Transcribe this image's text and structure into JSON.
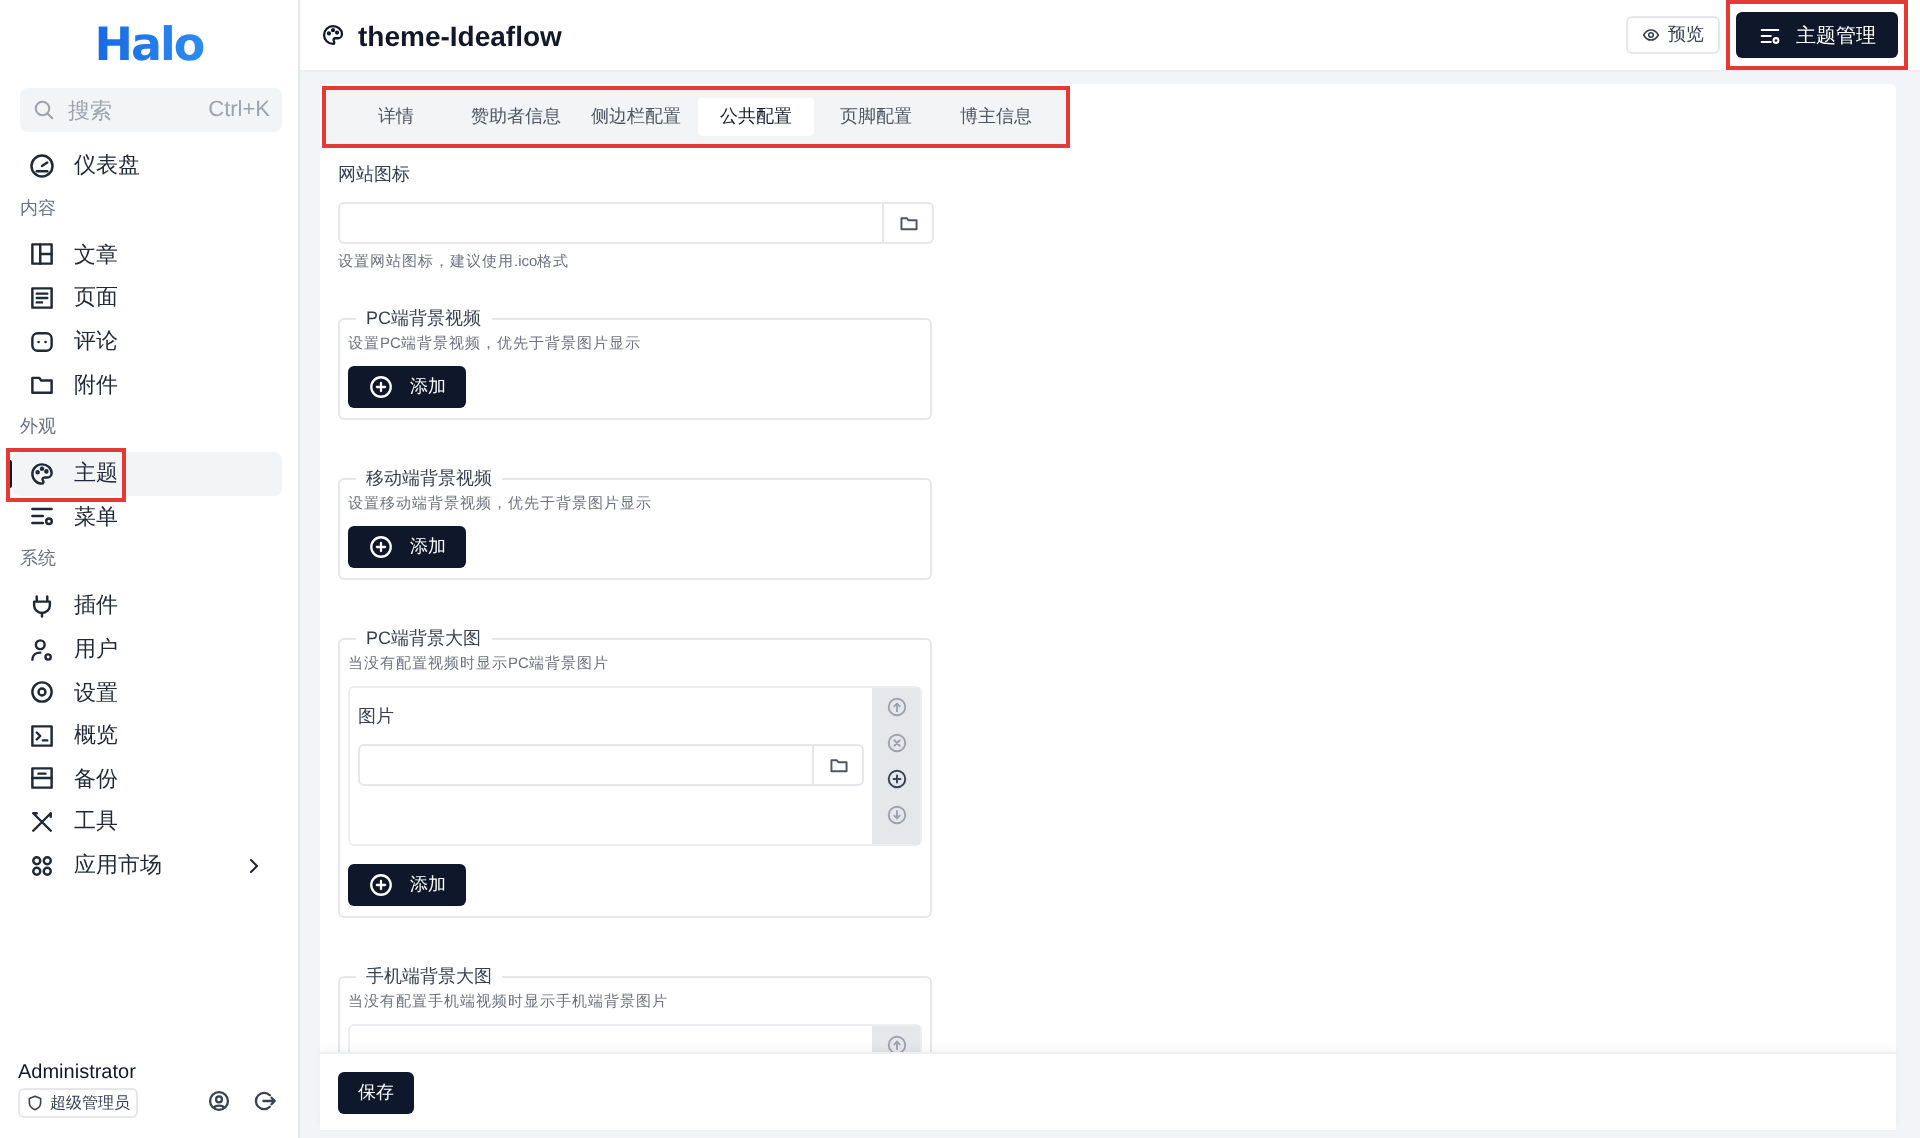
{
  "sidebar": {
    "logo": "Halo",
    "search": {
      "placeholder": "搜索",
      "shortcut": "Ctrl+K"
    },
    "groups": [
      {
        "items": [
          {
            "label": "仪表盘",
            "selected": false,
            "expandable": false
          }
        ]
      },
      {
        "heading": "内容",
        "items": [
          {
            "label": "文章",
            "selected": false,
            "expandable": false
          },
          {
            "label": "页面",
            "selected": false,
            "expandable": false
          },
          {
            "label": "评论",
            "selected": false,
            "expandable": false
          },
          {
            "label": "附件",
            "selected": false,
            "expandable": false
          }
        ]
      },
      {
        "heading": "外观",
        "items": [
          {
            "label": "主题",
            "selected": true,
            "highlighted": true,
            "expandable": false
          },
          {
            "label": "菜单",
            "selected": false,
            "highlighted": false,
            "expandable": false
          }
        ]
      },
      {
        "heading": "系统",
        "items": [
          {
            "label": "插件",
            "selected": false,
            "expandable": false
          },
          {
            "label": "用户",
            "selected": false,
            "expandable": false
          },
          {
            "label": "设置",
            "selected": false,
            "expandable": false
          },
          {
            "label": "概览",
            "selected": false,
            "expandable": false
          },
          {
            "label": "备份",
            "selected": false,
            "expandable": false
          },
          {
            "label": "工具",
            "selected": false,
            "expandable": false
          },
          {
            "label": "应用市场",
            "selected": false,
            "expandable": true
          }
        ]
      }
    ],
    "user": {
      "name": "Administrator",
      "role": "超级管理员"
    }
  },
  "header": {
    "title": "theme-Ideaflow",
    "preview_button": "预览",
    "manage_button": {
      "label": "主题管理",
      "highlighted": true
    }
  },
  "tabs": {
    "highlighted": true,
    "items": [
      {
        "label": "详情",
        "selected": false
      },
      {
        "label": "赞助者信息",
        "selected": false
      },
      {
        "label": "侧边栏配置",
        "selected": false
      },
      {
        "label": "公共配置",
        "selected": true
      },
      {
        "label": "页脚配置",
        "selected": false
      },
      {
        "label": "博主信息",
        "selected": false
      }
    ]
  },
  "form": {
    "fields": [
      {
        "kind": "file",
        "label": "网站图标",
        "help": "设置网站图标，建议使用.ico格式"
      },
      {
        "kind": "repeater",
        "title": "PC端背景视频",
        "help": "设置PC端背景视频，优先于背景图片显示",
        "add_button": "添加"
      },
      {
        "kind": "repeater",
        "title": "移动端背景视频",
        "help": "设置移动端背景视频，优先于背景图片显示",
        "add_button": "添加"
      },
      {
        "kind": "repeater",
        "title": "PC端背景大图",
        "help": "当没有配置视频时显示PC端背景图片",
        "items": [
          {
            "label": "图片"
          }
        ],
        "add_button": "添加"
      },
      {
        "kind": "repeater",
        "title": "手机端背景大图",
        "help": "当没有配置手机端视频时显示手机端背景图片",
        "clipped_item": true
      }
    ]
  },
  "save_button": "保存"
}
